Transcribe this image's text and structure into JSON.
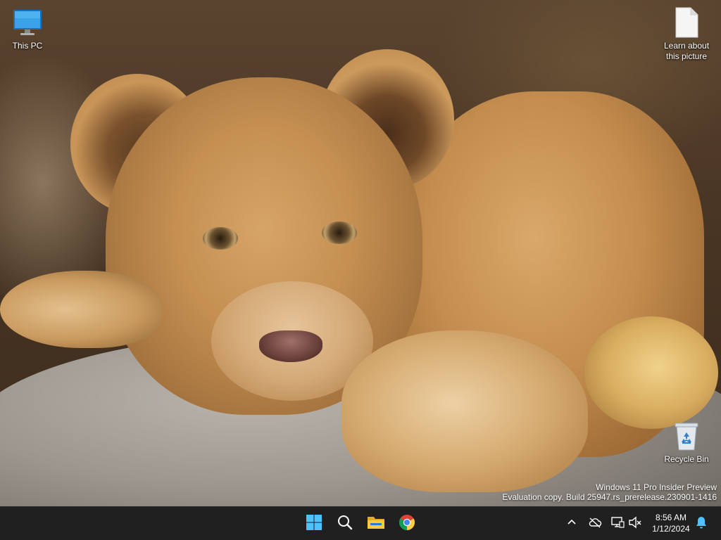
{
  "desktop": {
    "icons": [
      {
        "label": "This PC",
        "icon": "monitor-icon"
      },
      {
        "label_line1": "Learn about",
        "label_line2": "this picture",
        "icon": "document-icon"
      },
      {
        "label": "Recycle Bin",
        "icon": "recycle-bin-icon"
      }
    ],
    "watermark": {
      "line1": "Windows 11 Pro Insider Preview",
      "line2": "Evaluation copy. Build 25947.rs_prerelease.230901-1416"
    }
  },
  "taskbar": {
    "apps": [
      {
        "name": "Start",
        "icon": "windows-start-icon",
        "color": "#4cc2ff"
      },
      {
        "name": "Search",
        "icon": "search-icon"
      },
      {
        "name": "File Explorer",
        "icon": "folder-icon",
        "color": "#ffc83d"
      },
      {
        "name": "Google Chrome",
        "icon": "chrome-icon"
      }
    ],
    "tray": {
      "icons": [
        "chevron-up-icon",
        "cloud-offline-icon",
        "network-icon",
        "volume-muted-icon",
        "notification-bell-icon"
      ],
      "time": "8:56 AM",
      "date": "1/12/2024",
      "accent": "#4cc2ff"
    }
  }
}
